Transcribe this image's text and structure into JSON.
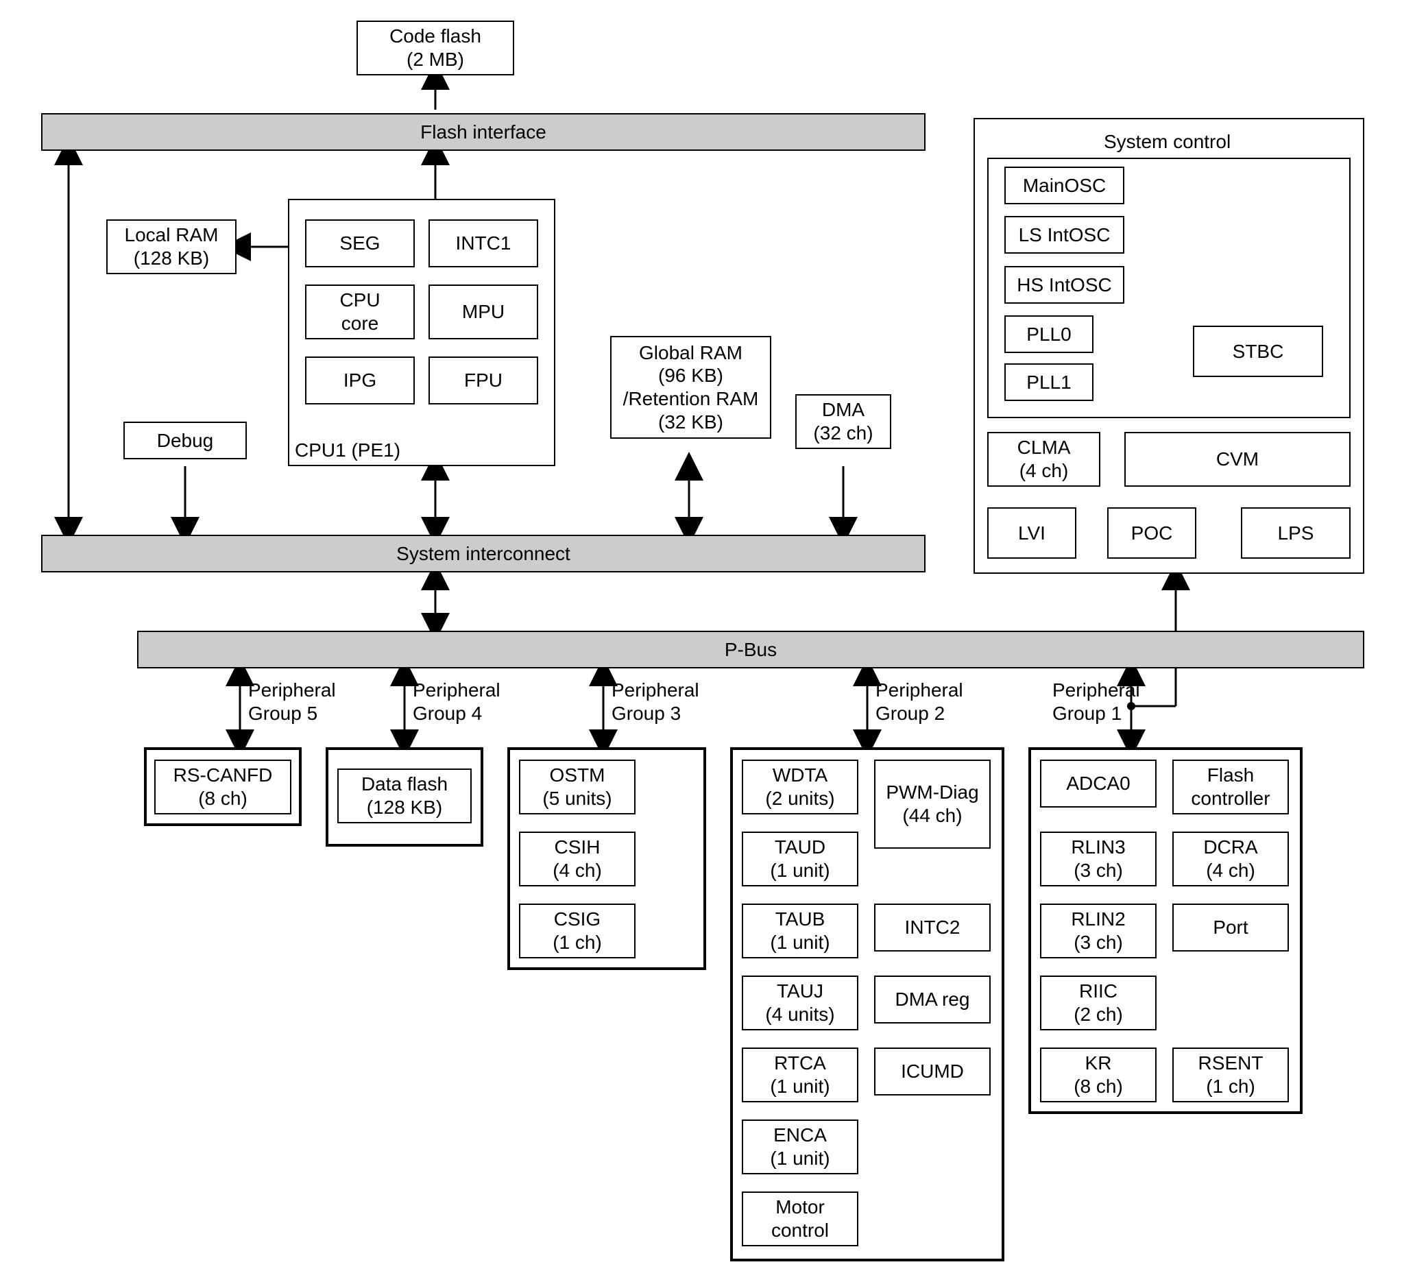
{
  "code_flash": "Code flash\n(2 MB)",
  "flash_interface": "Flash interface",
  "local_ram": "Local RAM\n(128 KB)",
  "cpu1_label": "CPU1 (PE1)",
  "cpu_seg": "SEG",
  "cpu_intc1": "INTC1",
  "cpu_core": "CPU\ncore",
  "cpu_mpu": "MPU",
  "cpu_ipg": "IPG",
  "cpu_fpu": "FPU",
  "debug": "Debug",
  "global_ram": "Global RAM\n(96 KB)\n/Retention RAM\n(32 KB)",
  "dma": "DMA\n(32 ch)",
  "system_interconnect": "System interconnect",
  "pbus": "P-Bus",
  "system_control_label": "System control",
  "mainosc": "MainOSC",
  "ls_intosc": "LS IntOSC",
  "hs_intosc": "HS IntOSC",
  "pll0": "PLL0",
  "pll1": "PLL1",
  "stbc": "STBC",
  "clma": "CLMA\n(4 ch)",
  "cvm": "CVM",
  "lvi": "LVI",
  "poc": "POC",
  "lps": "LPS",
  "pg1": "Peripheral\nGroup 1",
  "pg2": "Peripheral\nGroup 2",
  "pg3": "Peripheral\nGroup 3",
  "pg4": "Peripheral\nGroup 4",
  "pg5": "Peripheral\nGroup 5",
  "rscanfd": "RS-CANFD\n(8 ch)",
  "data_flash": "Data flash\n(128 KB)",
  "ostm": "OSTM\n(5 units)",
  "csih": "CSIH\n(4 ch)",
  "csig": "CSIG\n(1 ch)",
  "wdta": "WDTA\n(2 units)",
  "taud": "TAUD\n(1 unit)",
  "taub": "TAUB\n(1 unit)",
  "tauj": "TAUJ\n(4 units)",
  "rtca": "RTCA\n(1 unit)",
  "enca": "ENCA\n(1 unit)",
  "motor": "Motor\ncontrol",
  "pwmdiag": "PWM-Diag\n(44 ch)",
  "intc2": "INTC2",
  "dmareg": "DMA reg",
  "icumd": "ICUMD",
  "adca0": "ADCA0",
  "rlin3": "RLIN3\n(3 ch)",
  "rlin2": "RLIN2\n(3 ch)",
  "riic": "RIIC\n(2 ch)",
  "kr": "KR\n(8 ch)",
  "flashctrl": "Flash\ncontroller",
  "dcra": "DCRA\n(4 ch)",
  "port": "Port",
  "rsent": "RSENT\n(1 ch)"
}
